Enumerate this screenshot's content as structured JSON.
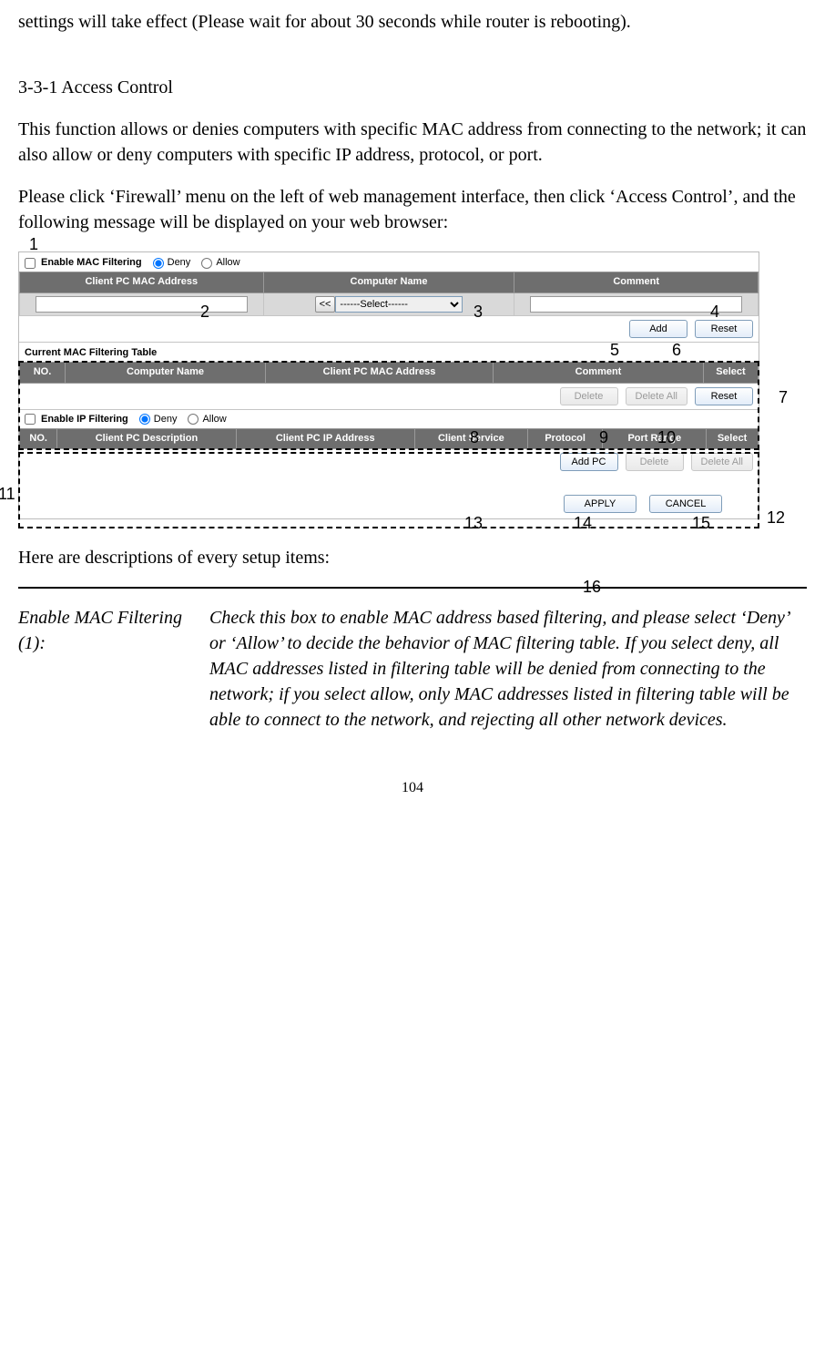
{
  "preamble_text": "settings will take effect (Please wait for about 30 seconds while router is rebooting).",
  "section_heading": "3-3-1 Access Control",
  "para1": "This function allows or denies computers with specific MAC address from connecting to the network; it can also allow or deny computers with specific IP address, protocol, or port.",
  "para2": "Please click ‘Firewall’ menu on the left of web management interface, then click ‘Access Control’, and the following message will be displayed on your web browser:",
  "mac": {
    "enable_label": "Enable MAC Filtering",
    "deny_label": "Deny",
    "allow_label": "Allow",
    "col_mac": "Client PC MAC Address",
    "col_name": "Computer Name",
    "col_comment": "Comment",
    "select_default": "------Select------",
    "btn_ll": "<<",
    "btn_add": "Add",
    "btn_reset": "Reset"
  },
  "mac_table": {
    "title": "Current MAC Filtering Table",
    "col_no": "NO.",
    "col_name": "Computer Name",
    "col_mac": "Client PC MAC Address",
    "col_comment": "Comment",
    "col_select": "Select",
    "btn_delete": "Delete",
    "btn_delete_all": "Delete All",
    "btn_reset": "Reset"
  },
  "ip": {
    "enable_label": "Enable IP Filtering",
    "deny_label": "Deny",
    "allow_label": "Allow",
    "col_no": "NO.",
    "col_desc": "Client PC Description",
    "col_ip": "Client PC IP Address",
    "col_service": "Client Service",
    "col_proto": "Protocol",
    "col_port": "Port Range",
    "col_select": "Select",
    "btn_add_pc": "Add PC",
    "btn_delete": "Delete",
    "btn_delete_all": "Delete All"
  },
  "bottom": {
    "btn_apply": "APPLY",
    "btn_cancel": "CANCEL"
  },
  "callouts": {
    "c1": "1",
    "c2": "2",
    "c3": "3",
    "c4": "4",
    "c5": "5",
    "c6": "6",
    "c7": "7",
    "c8": "8",
    "c9": "9",
    "c10": "10",
    "c11": "11",
    "c12": "12",
    "c13": "13",
    "c14": "14",
    "c15": "15",
    "c16": "16"
  },
  "after_fig": "Here are descriptions of every setup items:",
  "def_term": "Enable MAC Filtering (1):",
  "def_desc": "Check this box to enable MAC address based filtering, and please select ‘Deny’ or ‘Allow’ to decide the behavior of MAC filtering table. If you select deny, all MAC addresses listed in filtering table will be denied from connecting to the network; if you select allow, only MAC addresses listed in filtering table will be able to connect to the network, and rejecting all other network devices.",
  "page_number": "104"
}
